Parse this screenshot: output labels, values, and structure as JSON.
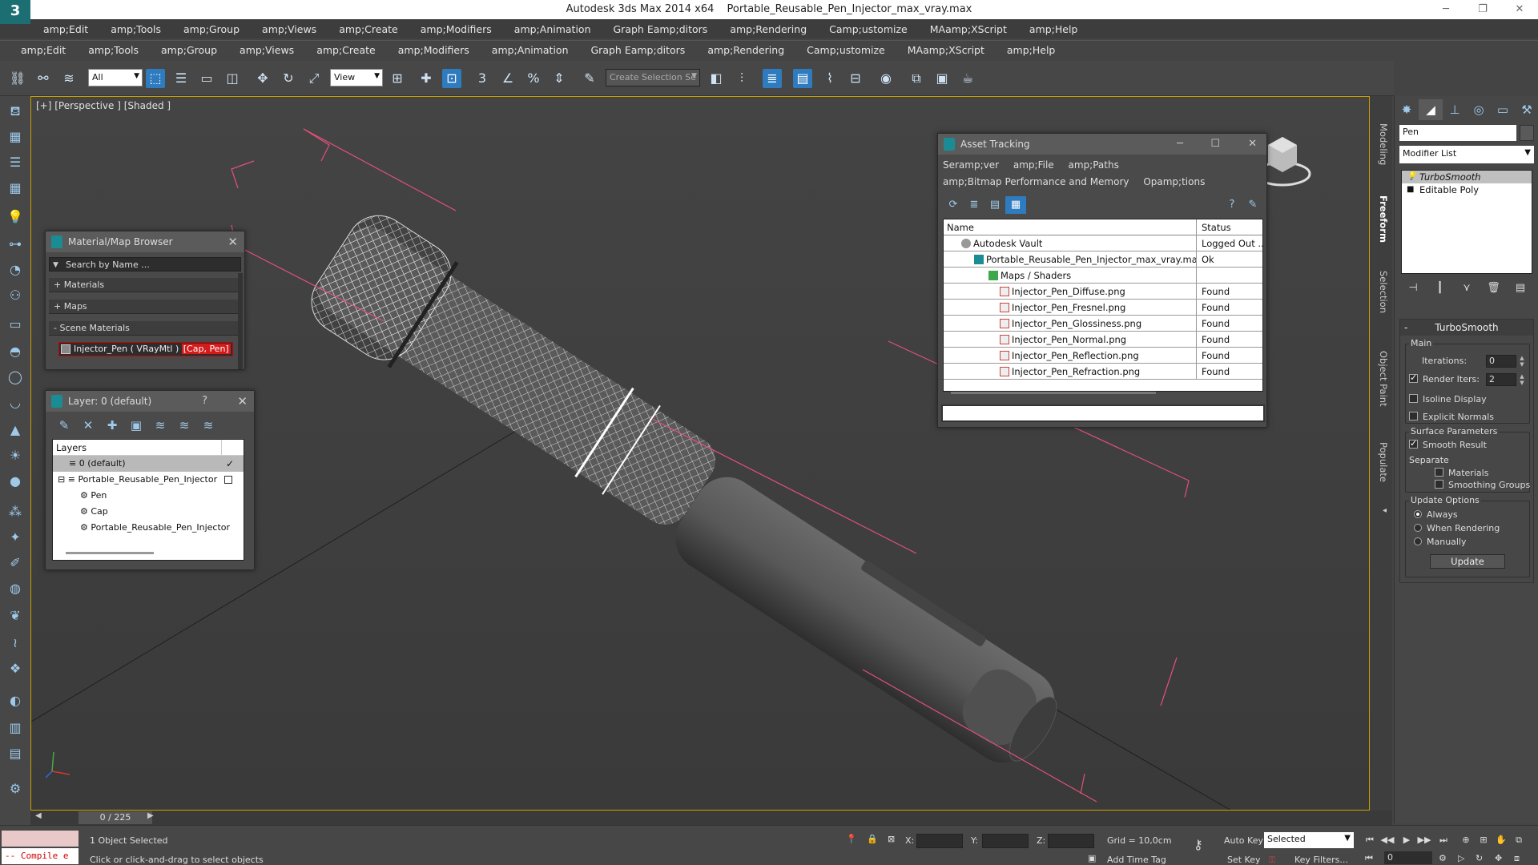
{
  "window": {
    "app_title": "Autodesk 3ds Max  2014 x64",
    "file_title": "Portable_Reusable_Pen_Injector_max_vray.max",
    "logo_glyph": "3"
  },
  "menu_primary": [
    "amp;Edit",
    "amp;Tools",
    "amp;Group",
    "amp;Views",
    "amp;Create",
    "amp;Modifiers",
    "amp;Animation",
    "Graph Eamp;ditors",
    "amp;Rendering",
    "Camp;ustomize",
    "MAamp;XScript",
    "amp;Help"
  ],
  "menu_secondary": [
    "amp;Edit",
    "amp;Tools",
    "amp;Group",
    "amp;Views",
    "amp;Create",
    "amp;Modifiers",
    "amp;Animation",
    "Graph Eamp;ditors",
    "amp;Rendering",
    "Camp;ustomize",
    "MAamp;XScript",
    "amp;Help"
  ],
  "toolbar": {
    "filter_value": "All",
    "refcoord_value": "View",
    "selection_set_placeholder": "Create Selection Se"
  },
  "viewport": {
    "label": "[+] [Perspective ] [Shaded ]",
    "accent_border": "#c8a000",
    "bbox_color": "#e0507a"
  },
  "material_browser": {
    "title": "Material/Map Browser",
    "search_placeholder": "Search by Name ...",
    "sections": [
      "+ Materials",
      "+ Maps",
      "- Scene Materials"
    ],
    "scene_item": "Injector_Pen  ( VRayMtl ) ",
    "scene_item_highlight": "[Cap, Pen]"
  },
  "layer_panel": {
    "title": "Layer: 0 (default)",
    "help": "?",
    "header": "Layers",
    "rows": [
      "0 (default)",
      "Portable_Reusable_Pen_Injector",
      "Pen",
      "Cap",
      "Portable_Reusable_Pen_Injector"
    ]
  },
  "asset_tracking": {
    "title": "Asset Tracking",
    "menu_row1": [
      "Seramp;ver",
      "amp;File",
      "amp;Paths"
    ],
    "menu_row2": [
      "amp;Bitmap Performance and Memory",
      "Opamp;tions"
    ],
    "col_name": "Name",
    "col_status": "Status",
    "rows": [
      {
        "name": "Autodesk Vault",
        "status": "Logged Out ..."
      },
      {
        "name": "Portable_Reusable_Pen_Injector_max_vray.max",
        "status": "Ok"
      },
      {
        "name": "Maps / Shaders",
        "status": ""
      },
      {
        "name": "Injector_Pen_Diffuse.png",
        "status": "Found"
      },
      {
        "name": "Injector_Pen_Fresnel.png",
        "status": "Found"
      },
      {
        "name": "Injector_Pen_Glossiness.png",
        "status": "Found"
      },
      {
        "name": "Injector_Pen_Normal.png",
        "status": "Found"
      },
      {
        "name": "Injector_Pen_Reflection.png",
        "status": "Found"
      },
      {
        "name": "Injector_Pen_Refraction.png",
        "status": "Found"
      }
    ]
  },
  "right_tabs": [
    "Modeling",
    "Freeform",
    "Selection",
    "Object Paint",
    "Populate"
  ],
  "command_panel": {
    "object_name": "Pen",
    "modifier_list": "Modifier List",
    "stack": [
      "TurboSmooth",
      "Editable Poly"
    ],
    "turbosmooth": {
      "title": "TurboSmooth",
      "main_group": "Main",
      "iterations_label": "Iterations:",
      "iterations_value": "0",
      "render_iters_label": "Render Iters:",
      "render_iters_value": "2",
      "isoline_display": "Isoline Display",
      "explicit_normals": "Explicit Normals",
      "surface_group": "Surface Parameters",
      "smooth_result": "Smooth Result",
      "separate_label": "Separate",
      "materials": "Materials",
      "smoothing_groups": "Smoothing Groups",
      "update_group": "Update Options",
      "always": "Always",
      "when_rendering": "When Rendering",
      "manually": "Manually",
      "update_button": "Update"
    }
  },
  "timeline": {
    "frame_range": "0 / 225"
  },
  "status": {
    "maxscript": "-- Compile e",
    "selection_info": "1 Object Selected",
    "prompt": "Click or click-and-drag to select objects",
    "x_label": "X:",
    "y_label": "Y:",
    "z_label": "Z:",
    "grid": "Grid = 10,0cm",
    "add_time_tag": "Add Time Tag",
    "auto_key": "Auto Key",
    "set_key": "Set Key",
    "selected_dropdown": "Selected",
    "key_filters": "Key Filters...",
    "frame_value": "0"
  }
}
